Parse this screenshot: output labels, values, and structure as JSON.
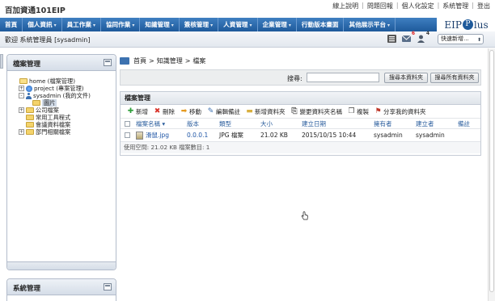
{
  "header": {
    "app_title": "百加資通101EIP",
    "links": [
      "線上說明",
      "問題回報",
      "個人化設定",
      "系統管理",
      "登出"
    ]
  },
  "nav": {
    "items": [
      {
        "label": "首頁",
        "caret": false
      },
      {
        "label": "個人資訊",
        "caret": true
      },
      {
        "label": "員工作業",
        "caret": true
      },
      {
        "label": "協同作業",
        "caret": true
      },
      {
        "label": "知識管理",
        "caret": true
      },
      {
        "label": "簽核管理",
        "caret": true
      },
      {
        "label": "人資管理",
        "caret": true
      },
      {
        "label": "企業管理",
        "caret": true
      },
      {
        "label": "行動版本畫面",
        "caret": false
      },
      {
        "label": "其他展示平台",
        "caret": true
      }
    ],
    "logo_text_1": "EIP",
    "logo_p": "P",
    "logo_text_2": "lus"
  },
  "welcome": {
    "text": "歡迎 系統管理員 [sysadmin]",
    "mail_count": "6",
    "user_count": "4",
    "quick_new": "快速新增..."
  },
  "sidebar": {
    "file_panel_title": "檔案管理",
    "tree": [
      {
        "label": "home (檔案管理)",
        "toggle": "",
        "icon": "folder-open-icon",
        "level": 0
      },
      {
        "label": "project (專案管理)",
        "toggle": "+",
        "icon": "globe-icon",
        "level": 1
      },
      {
        "label": "sysadmin (我的文件)",
        "toggle": "-",
        "icon": "user-icon",
        "level": 1
      },
      {
        "label": "圖片",
        "toggle": "",
        "icon": "folder-icon",
        "level": 2,
        "selected": true
      },
      {
        "label": "公司檔案",
        "toggle": "+",
        "icon": "folder-icon",
        "level": 1
      },
      {
        "label": "常用工具程式",
        "toggle": "",
        "icon": "folder-icon",
        "level": 1
      },
      {
        "label": "會議資料檔案",
        "toggle": "",
        "icon": "folder-icon",
        "level": 1
      },
      {
        "label": "部門相關檔案",
        "toggle": "+",
        "icon": "folder-icon",
        "level": 1
      }
    ],
    "system_panel_title": "系統管理"
  },
  "main": {
    "breadcrumb": [
      "首頁",
      "知識管理",
      "檔案"
    ],
    "breadcrumb_sep": ">",
    "search": {
      "label": "搜尋:",
      "value": "",
      "btn_this": "搜尋本資料夾",
      "btn_all": "搜尋所有資料夾"
    },
    "panel_title": "檔案管理",
    "toolbar": [
      {
        "label": "新增",
        "icon": "plus-icon",
        "color": "#2e9e3a"
      },
      {
        "label": "刪除",
        "icon": "x-icon",
        "color": "#d9342b"
      },
      {
        "label": "移動",
        "icon": "arrow-right-icon",
        "color": "#e59a1f"
      },
      {
        "label": "編輯備註",
        "icon": "pencil-icon",
        "color": "#3a6fb0"
      },
      {
        "label": "新增資料夾",
        "icon": "folder-icon",
        "color": "#d9b03f"
      },
      {
        "label": "變更資料夾名稱",
        "icon": "rename-icon",
        "color": "#555555"
      },
      {
        "label": "複製",
        "icon": "copy-icon",
        "color": "#555555"
      },
      {
        "label": "分享我的資料夾",
        "icon": "share-icon",
        "color": "#c0392b"
      }
    ],
    "columns": {
      "name": "檔案名稱",
      "version": "版本",
      "type": "類型",
      "size": "大小",
      "created": "建立日期",
      "owner": "擁有者",
      "creator": "建立者",
      "note": "備註"
    },
    "rows": [
      {
        "name": "滑鼠.jpg",
        "version": "0.0.0.1",
        "type": "JPG 檔案",
        "size": "21.02 KB",
        "created": "2015/10/15 10:44",
        "owner": "sysadmin",
        "creator": "sysadmin",
        "note": ""
      }
    ],
    "footer": "使用空間: 21.02 KB   檔案數目: 1"
  }
}
